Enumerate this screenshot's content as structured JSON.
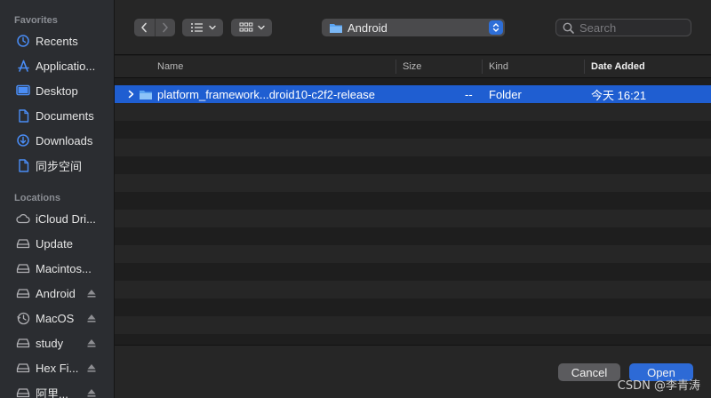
{
  "sidebar": {
    "favorites_title": "Favorites",
    "favorites": [
      {
        "label": "Recents",
        "icon": "clock-icon"
      },
      {
        "label": "Applicatio...",
        "icon": "applications-icon"
      },
      {
        "label": "Desktop",
        "icon": "desktop-icon"
      },
      {
        "label": "Documents",
        "icon": "document-icon"
      },
      {
        "label": "Downloads",
        "icon": "download-icon"
      },
      {
        "label": "同步空间",
        "icon": "document-icon"
      }
    ],
    "locations_title": "Locations",
    "locations": [
      {
        "label": "iCloud Dri...",
        "icon": "cloud-icon"
      },
      {
        "label": "Update",
        "icon": "drive-icon"
      },
      {
        "label": "Macintos...",
        "icon": "drive-icon"
      },
      {
        "label": "Android",
        "icon": "drive-icon"
      },
      {
        "label": "MacOS",
        "icon": "timemachine-icon"
      },
      {
        "label": "study",
        "icon": "drive-icon"
      },
      {
        "label": "Hex Fi...",
        "icon": "drive-icon"
      },
      {
        "label": "阿里...",
        "icon": "drive-icon"
      }
    ]
  },
  "toolbar": {
    "path_label": "Android",
    "search_placeholder": "Search"
  },
  "columns": {
    "name": "Name",
    "size": "Size",
    "kind": "Kind",
    "date_added": "Date Added"
  },
  "files": [
    {
      "name": "platform_framework...droid10-c2f2-release",
      "size": "--",
      "kind": "Folder",
      "date_added": "今天 16:21"
    }
  ],
  "buttons": {
    "cancel": "Cancel",
    "open": "Open"
  },
  "watermark": "CSDN @李青涛",
  "colors": {
    "accent": "#2d6ad6",
    "selection": "#1f5ed1",
    "sidebar_icon": "#4a8df6"
  }
}
